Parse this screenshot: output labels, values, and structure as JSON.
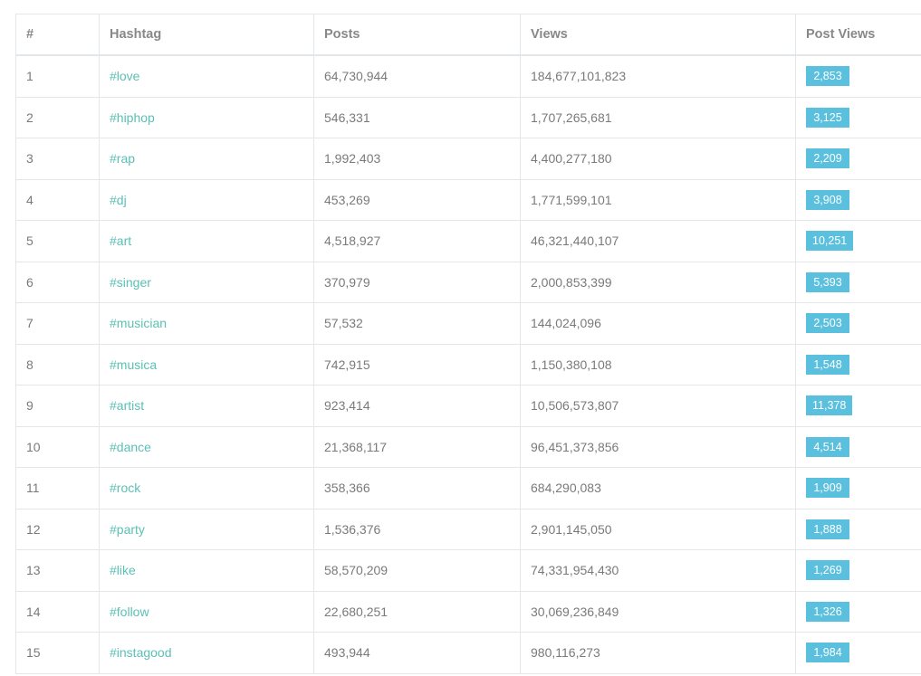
{
  "table": {
    "headers": {
      "rank": "#",
      "hashtag": "Hashtag",
      "posts": "Posts",
      "views": "Views",
      "post_views": "Post Views"
    },
    "rows": [
      {
        "rank": "1",
        "hashtag": "#love",
        "posts": "64,730,944",
        "views": "184,677,101,823",
        "post_views": "2,853"
      },
      {
        "rank": "2",
        "hashtag": "#hiphop",
        "posts": "546,331",
        "views": "1,707,265,681",
        "post_views": "3,125"
      },
      {
        "rank": "3",
        "hashtag": "#rap",
        "posts": "1,992,403",
        "views": "4,400,277,180",
        "post_views": "2,209"
      },
      {
        "rank": "4",
        "hashtag": "#dj",
        "posts": "453,269",
        "views": "1,771,599,101",
        "post_views": "3,908"
      },
      {
        "rank": "5",
        "hashtag": "#art",
        "posts": "4,518,927",
        "views": "46,321,440,107",
        "post_views": "10,251"
      },
      {
        "rank": "6",
        "hashtag": "#singer",
        "posts": "370,979",
        "views": "2,000,853,399",
        "post_views": "5,393"
      },
      {
        "rank": "7",
        "hashtag": "#musician",
        "posts": "57,532",
        "views": "144,024,096",
        "post_views": "2,503"
      },
      {
        "rank": "8",
        "hashtag": "#musica",
        "posts": "742,915",
        "views": "1,150,380,108",
        "post_views": "1,548"
      },
      {
        "rank": "9",
        "hashtag": "#artist",
        "posts": "923,414",
        "views": "10,506,573,807",
        "post_views": "11,378"
      },
      {
        "rank": "10",
        "hashtag": "#dance",
        "posts": "21,368,117",
        "views": "96,451,373,856",
        "post_views": "4,514"
      },
      {
        "rank": "11",
        "hashtag": "#rock",
        "posts": "358,366",
        "views": "684,290,083",
        "post_views": "1,909"
      },
      {
        "rank": "12",
        "hashtag": "#party",
        "posts": "1,536,376",
        "views": "2,901,145,050",
        "post_views": "1,888"
      },
      {
        "rank": "13",
        "hashtag": "#like",
        "posts": "58,570,209",
        "views": "74,331,954,430",
        "post_views": "1,269"
      },
      {
        "rank": "14",
        "hashtag": "#follow",
        "posts": "22,680,251",
        "views": "30,069,236,849",
        "post_views": "1,326"
      },
      {
        "rank": "15",
        "hashtag": "#instagood",
        "posts": "493,944",
        "views": "980,116,273",
        "post_views": "1,984"
      }
    ]
  },
  "colors": {
    "link": "#5bc0b5",
    "badge_bg": "#5bc0de",
    "border": "#e3e7ea"
  }
}
